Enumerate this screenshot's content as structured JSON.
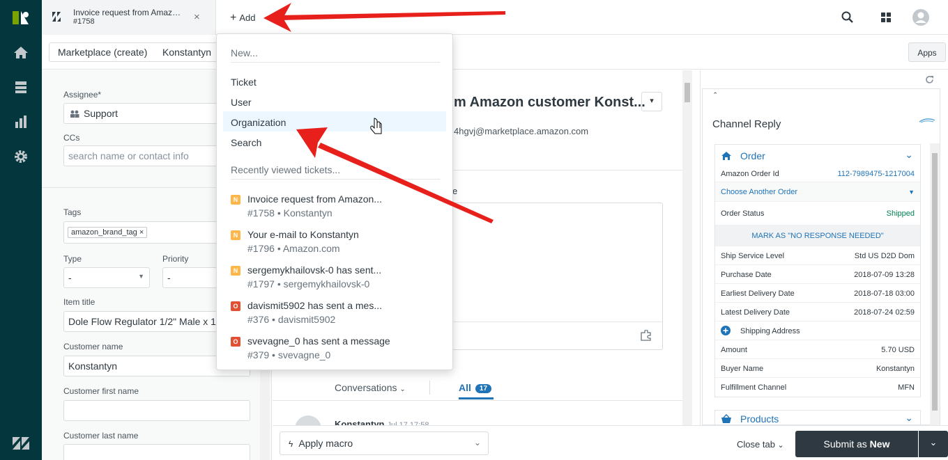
{
  "colors": {
    "nav_bg": "#03363d",
    "accent": "#1f73b7",
    "arrow": "#e8201c",
    "new_badge": "#ffb648",
    "open_badge": "#e34f32",
    "shipped": "#038153",
    "submit_bg": "#2f3941"
  },
  "tab": {
    "title": "Invoice request from Amazon...",
    "number": "#1758",
    "close": "×"
  },
  "add_button": {
    "label": "Add"
  },
  "subbar": {
    "crumb1": "Marketplace (create)",
    "crumb2": "Konstantyn",
    "apps": "Apps"
  },
  "fields": {
    "assignee_label": "Assignee*",
    "assignee_value": "Support",
    "ccs_label": "CCs",
    "ccs_placeholder": "search name or contact info",
    "tags_label": "Tags",
    "tag": "amazon_brand_tag",
    "type_label": "Type",
    "type_value": "-",
    "priority_label": "Priority",
    "priority_value": "-",
    "item_title_label": "Item title",
    "item_title_value": "Dole Flow Regulator 1/2\" Male x 1/",
    "customer_name_label": "Customer name",
    "customer_name_value": "Konstantyn",
    "customer_first_label": "Customer first name",
    "customer_last_label": "Customer last name"
  },
  "main": {
    "subject": "m Amazon customer Konst...",
    "email": "4hgvj@marketplace.amazon.com",
    "reply_label": "e",
    "conversations": "Conversations",
    "all": "All",
    "all_count": "17",
    "author": "Konstantyn",
    "author_time": "Jul 17 17:58"
  },
  "dropdown": {
    "new": "New...",
    "items": [
      "Ticket",
      "User",
      "Organization",
      "Search"
    ],
    "recent_header": "Recently viewed tickets...",
    "recent": [
      {
        "badge": "N",
        "title": "Invoice request from Amazon...",
        "sub": "#1758 • Konstantyn"
      },
      {
        "badge": "N",
        "title": "Your e-mail to Konstantyn",
        "sub": "#1796 • Amazon.com"
      },
      {
        "badge": "N",
        "title": "sergemykhailovsk-0 has sent...",
        "sub": "#1797 • sergemykhailovsk-0"
      },
      {
        "badge": "O",
        "title": "davismit5902 has sent a mes...",
        "sub": "#376 • davismit5902"
      },
      {
        "badge": "O",
        "title": "svevagne_0 has sent a message",
        "sub": "#379 • svevagne_0"
      }
    ]
  },
  "app": {
    "title": "Channel Reply",
    "order": "Order",
    "order_id_label": "Amazon Order Id",
    "order_id": "112-7989475-1217004",
    "choose": "Choose Another Order",
    "status_label": "Order Status",
    "status": "Shipped",
    "mark": "MARK AS \"NO RESPONSE NEEDED\"",
    "rows": [
      {
        "k": "Ship Service Level",
        "v": "Std US D2D Dom"
      },
      {
        "k": "Purchase Date",
        "v": "2018-07-09 13:28"
      },
      {
        "k": "Earliest Delivery Date",
        "v": "2018-07-18 03:00"
      },
      {
        "k": "Latest Delivery Date",
        "v": "2018-07-24 02:59"
      }
    ],
    "shipping": "Shipping Address",
    "rows2": [
      {
        "k": "Amount",
        "v": "5.70 USD"
      },
      {
        "k": "Buyer Name",
        "v": "Konstantyn"
      },
      {
        "k": "Fulfillment Channel",
        "v": "MFN"
      }
    ],
    "products": "Products"
  },
  "bottom": {
    "macro": "Apply macro",
    "close_tab": "Close tab",
    "submit_prefix": "Submit as",
    "submit_status": "New"
  }
}
